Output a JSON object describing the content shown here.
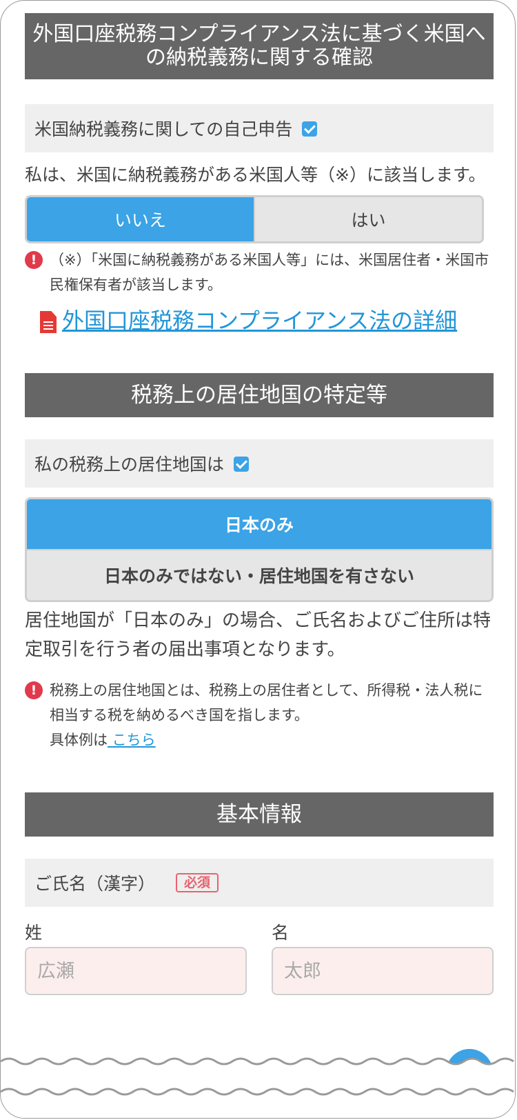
{
  "fatca": {
    "title": "外国口座税務コンプライアンス法に基づく米国への納税義務に関する確認",
    "self_report_label": "米国納税義務に関しての自己申告",
    "statement": "私は、米国に納税義務がある米国人等（※）に該当します。",
    "options": [
      "いいえ",
      "はい"
    ],
    "selected": "いいえ",
    "note": "（※）「米国に納税義務がある米国人等」には、米国居住者・米国市民権保有者が該当します。",
    "link_text": "外国口座税務コンプライアンス法の詳細"
  },
  "residence": {
    "title": "税務上の居住地国の特定等",
    "label": "私の税務上の居住地国は",
    "options": [
      "日本のみ",
      "日本のみではない・居住地国を有さない"
    ],
    "selected": "日本のみ",
    "description": "居住地国が「日本のみ」の場合、ご氏名およびご住所は特定取引を行う者の届出事項となります。",
    "note": "税務上の居住地国とは、税務上の居住者として、所得税・法人税に相当する税を納めるべき国を指します。",
    "example_prefix": "具体例は",
    "example_link": " こちら "
  },
  "basic": {
    "title": "基本情報",
    "name_label": "ご氏名（漢字）",
    "required": "必須",
    "last_name_label": "姓",
    "first_name_label": "名",
    "last_name_placeholder": "広瀬",
    "first_name_placeholder": "太郎"
  },
  "colors": {
    "accent": "#3ba3e6",
    "header": "#666666",
    "alert": "#e03a4b",
    "link": "#2196d8",
    "required": "#e8636e"
  },
  "icons": [
    "checkbox-checked-icon",
    "alert-icon",
    "pdf-document-icon"
  ]
}
